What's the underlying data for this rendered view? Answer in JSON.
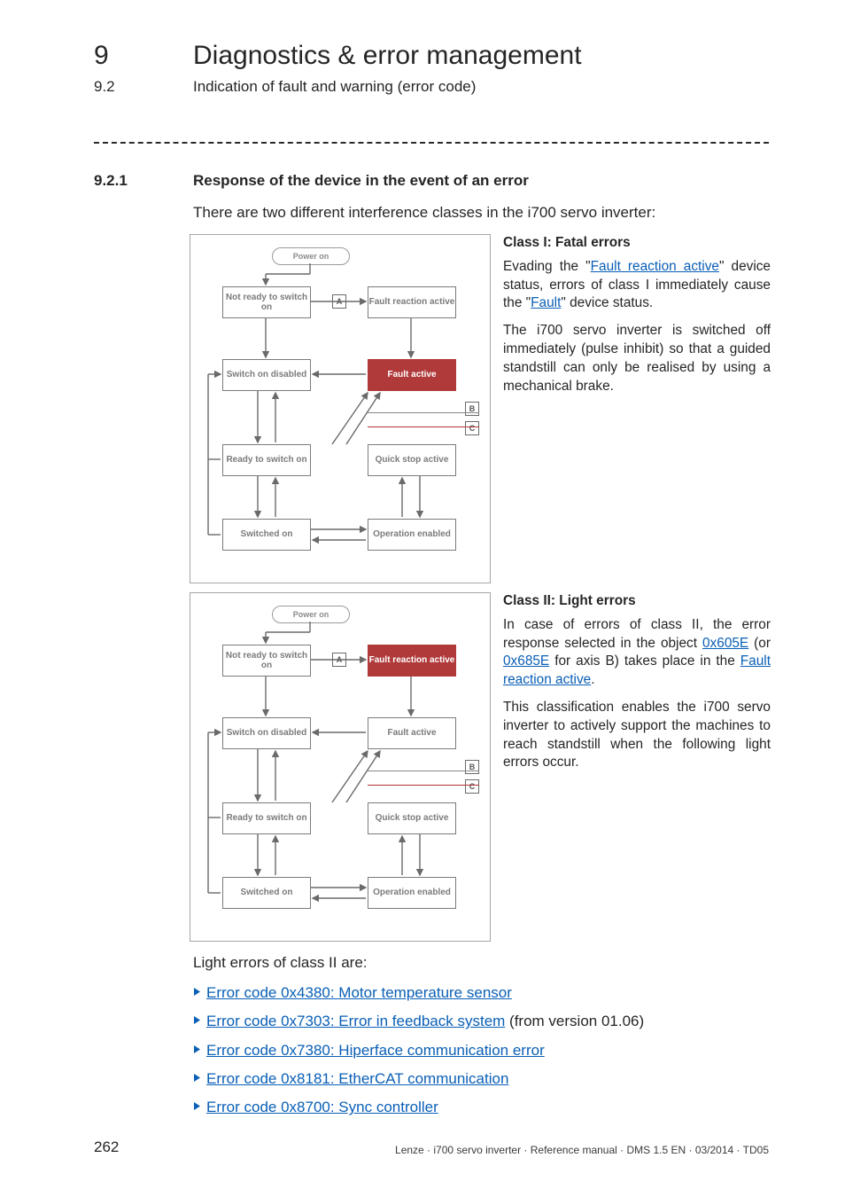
{
  "header": {
    "chapter_num": "9",
    "chapter_title": "Diagnostics & error management",
    "section_num": "9.2",
    "section_title": "Indication of fault and warning (error code)"
  },
  "section": {
    "num": "9.2.1",
    "title": "Response of the device in the event of an error",
    "intro": "There are two different interference classes in the i700 servo inverter:"
  },
  "fig_labels": {
    "power_on": "Power on",
    "not_ready": "Not ready to switch on",
    "fault_reaction": "Fault reaction active",
    "switch_on_disabled": "Switch on disabled",
    "fault_active": "Fault active",
    "ready_switch_on": "Ready to switch on",
    "quick_stop": "Quick stop active",
    "switched_on": "Switched on",
    "operation_enabled": "Operation enabled",
    "badge_A": "A",
    "badge_B": "B",
    "badge_C": "C"
  },
  "class1": {
    "header": "Class I: Fatal errors",
    "p1a": "Evading the \"",
    "p1_link1": "Fault reaction active",
    "p1b": "\" device status, errors of class I immediately cause the \"",
    "p1_link2": "Fault",
    "p1c": "\" device status.",
    "p2": "The i700 servo inverter is switched off immediately (pulse inhibit) so that a guided standstill can only be realised by using a mechanical brake."
  },
  "class2": {
    "header": "Class II: Light errors",
    "p1a": "In case of errors of class II, the error response selected in the object ",
    "link1": "0x605E",
    "p1b": " (or ",
    "link2": "0x685E",
    "p1c": " for axis B) takes place in the ",
    "link3": "Fault reaction active",
    "p1d": ".",
    "p2": "This classification enables the i700 servo inverter to actively support the machines to reach standstill when the following light errors occur."
  },
  "list_caption": "Light errors of class II are:",
  "errors": [
    {
      "text": "Error code 0x4380: Motor temperature sensor",
      "suffix": ""
    },
    {
      "text": "Error code 0x7303: Error in feedback system",
      "suffix": " (from version 01.06)"
    },
    {
      "text": "Error code 0x7380: Hiperface communication error",
      "suffix": ""
    },
    {
      "text": "Error code 0x8181: EtherCAT communication",
      "suffix": ""
    },
    {
      "text": "Error code 0x8700: Sync controller",
      "suffix": ""
    }
  ],
  "footer": {
    "page": "262",
    "right": "Lenze · i700 servo inverter · Reference manual · DMS 1.5 EN · 03/2014 · TD05"
  }
}
